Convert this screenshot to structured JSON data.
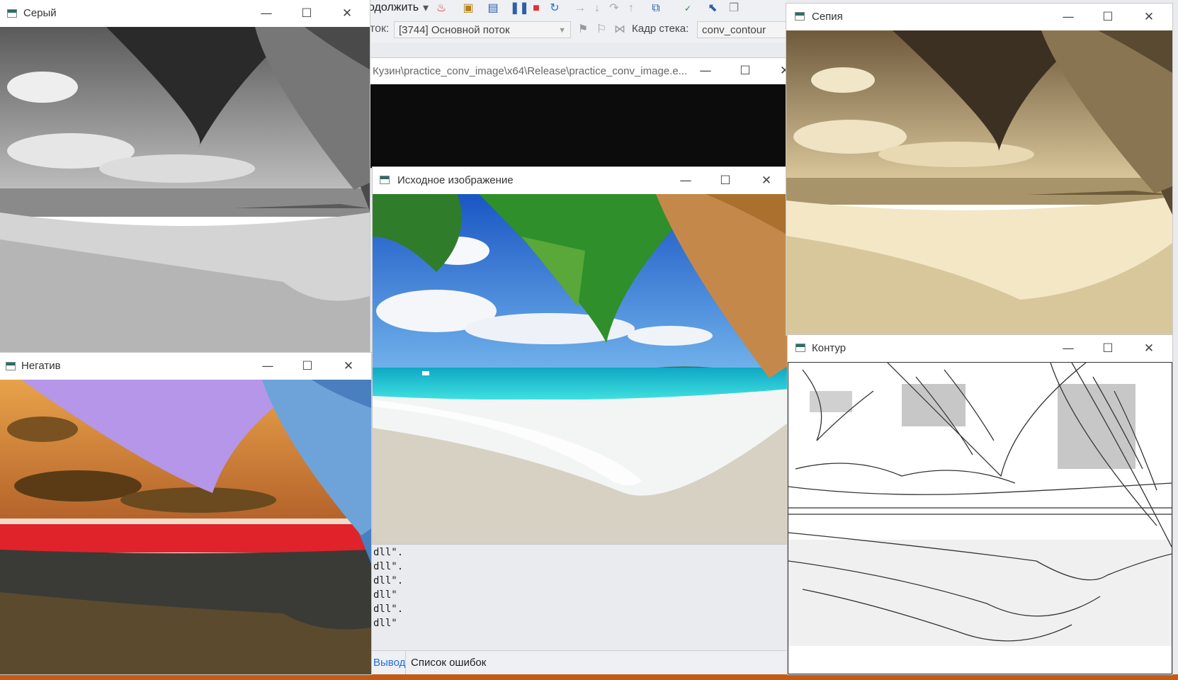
{
  "ide": {
    "toolbar_continue": "одолжить",
    "thread_label": "ток:",
    "thread_value": "[3744] Основной поток",
    "stack_label": "Кадр стека:",
    "stack_value": "conv_contour",
    "icons": [
      "dropdown-icon",
      "flame-icon",
      "folder-icon",
      "window-icon",
      "pause-icon",
      "stop-icon",
      "restart-icon",
      "step-over-icon",
      "step-into-icon",
      "step-back-icon",
      "step-out-icon",
      "hex-icon",
      "spellcheck-icon",
      "cursor-icon",
      "copy-icon"
    ]
  },
  "console_window": {
    "title": "Кузин\\practice_conv_image\\x64\\Release\\practice_conv_image.e..."
  },
  "output": {
    "lines": [
      "dll\".",
      "dll\".",
      "dll\".",
      "dll\"",
      "dll\".",
      "dll\""
    ]
  },
  "tabs": {
    "output": "Вывод",
    "errors": "Список ошибок"
  },
  "windows": {
    "gray": {
      "title": "Серый"
    },
    "negative": {
      "title": "Негатив"
    },
    "original": {
      "title": "Исходное изображение"
    },
    "sepia": {
      "title": "Сепия"
    },
    "contour": {
      "title": "Контур"
    }
  },
  "window_controls": {
    "minimize": "—",
    "maximize": "☐",
    "close": "✕"
  },
  "colors": {
    "accent": "#1e6fd9",
    "status_bar": "#c55a16",
    "stop": "#e0312f",
    "ide_bg": "#eef0f4"
  }
}
